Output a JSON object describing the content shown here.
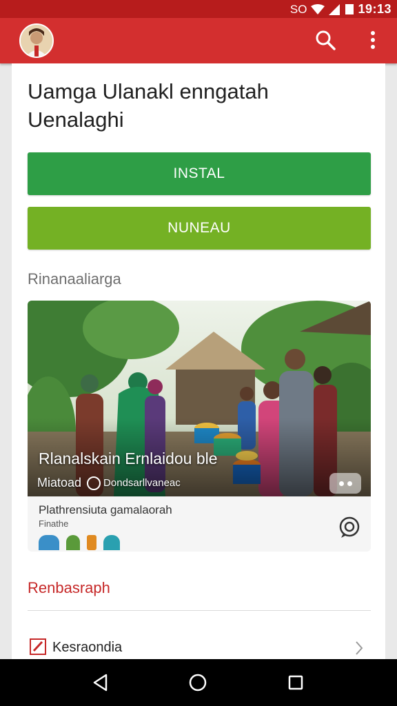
{
  "status_bar": {
    "time": "19:13",
    "indicators": "SO"
  },
  "app_bar": {
    "avatar_icon": "avatar",
    "search_icon": "search-icon",
    "more_icon": "more-vert-icon",
    "bg_color": "#d32f2f"
  },
  "content": {
    "title": "Uamga Ulanakl enngatah Uenalaghi",
    "primary_button": "INSTAL",
    "secondary_button": "NUNEAU",
    "section_label": "Rinanaaliarga",
    "media_card": {
      "title": "Rlanalskain Ernlaidou ble",
      "subtitle_left": "Miatoad",
      "subtitle_meta": "Dondsarllvaneac",
      "footer_line1": "Plathrensiuta gamalaorah",
      "footer_line2": "Finathe"
    },
    "section2_label": "Renbasraph",
    "list_row": {
      "label": "Kesraondia"
    }
  },
  "colors": {
    "accent": "#d32f2f",
    "primary_button": "#2e9e46",
    "secondary_button": "#74b124",
    "section2": "#c62828"
  }
}
